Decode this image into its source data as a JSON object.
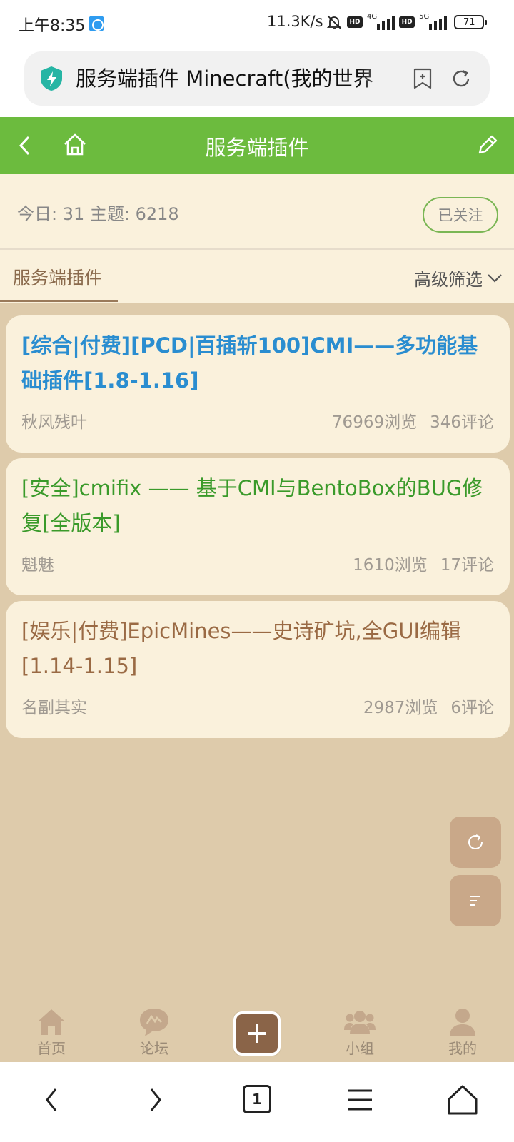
{
  "status_bar": {
    "time": "上午8:35",
    "net_speed": "11.3K/s",
    "hd_label": "HD",
    "net_4g": "4G",
    "net_5g": "5G",
    "battery": "71"
  },
  "browser": {
    "address_text": "服务端插件 Minecraft(我的世界"
  },
  "header": {
    "title": "服务端插件"
  },
  "forum": {
    "stats": "今日: 31 主题: 6218",
    "follow_label": "已关注"
  },
  "tabs": {
    "active_label": "服务端插件",
    "filter_label": "高级筛选"
  },
  "posts": [
    {
      "title": "[综合|付费][PCD|百插斩100]CMI——多功能基础插件[1.8-1.16]",
      "author": "秋风残叶",
      "views": "76969浏览",
      "comments": "346评论",
      "title_color": "#2a8dd0"
    },
    {
      "title": "[安全]cmifix —— 基于CMI与BentoBox的BUG修复[全版本]",
      "author": "魁魅",
      "views": "1610浏览",
      "comments": "17评论",
      "title_color": "#3a9a2a"
    },
    {
      "title": "[娱乐|付费]EpicMines——史诗矿坑,全GUI编辑[1.14-1.15]",
      "author": "名副其实",
      "views": "2987浏览",
      "comments": "6评论",
      "title_color": "#9a6a44"
    }
  ],
  "bottom_nav": {
    "items": [
      {
        "label": "首页",
        "icon": "home-icon"
      },
      {
        "label": "论坛",
        "icon": "forum-icon"
      },
      {
        "label": "小组",
        "icon": "group-icon"
      },
      {
        "label": "我的",
        "icon": "profile-icon"
      }
    ]
  },
  "system_nav": {
    "tab_count": "1"
  },
  "colors": {
    "header_green": "#6cbb3e",
    "page_bg": "#decbab",
    "card_bg": "#faf1dc",
    "accent_brown": "#8a6448"
  }
}
